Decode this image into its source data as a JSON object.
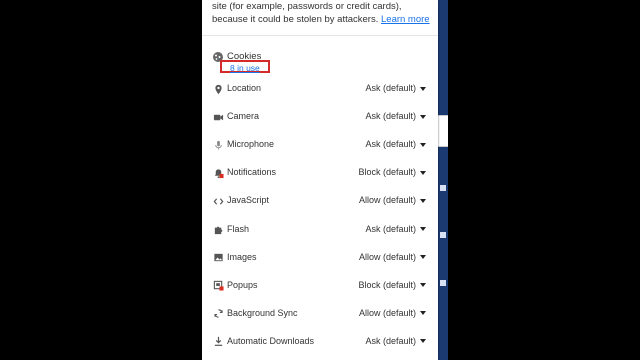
{
  "intro": {
    "text": "site (for example, passwords or credit cards), because it could be stolen by attackers.",
    "link": "Learn more"
  },
  "cookies": {
    "label": "Cookies",
    "in_use_link": "8 in use",
    "icon": "cookie-icon"
  },
  "permissions": [
    {
      "label": "Location",
      "value": "Ask (default)",
      "icon": "location-pin-icon"
    },
    {
      "label": "Camera",
      "value": "Ask (default)",
      "icon": "camera-icon"
    },
    {
      "label": "Microphone",
      "value": "Ask (default)",
      "icon": "microphone-icon"
    },
    {
      "label": "Notifications",
      "value": "Block (default)",
      "icon": "notifications-icon"
    },
    {
      "label": "JavaScript",
      "value": "Allow (default)",
      "icon": "code-icon"
    },
    {
      "label": "Flash",
      "value": "Ask (default)",
      "icon": "puzzle-icon"
    },
    {
      "label": "Images",
      "value": "Allow (default)",
      "icon": "image-icon"
    },
    {
      "label": "Popups",
      "value": "Block (default)",
      "icon": "popup-icon"
    },
    {
      "label": "Background Sync",
      "value": "Allow (default)",
      "icon": "sync-icon"
    },
    {
      "label": "Automatic Downloads",
      "value": "Ask (default)",
      "icon": "download-icon"
    }
  ],
  "colors": {
    "highlight": "#d42a2a",
    "link": "#1a73e8",
    "background_strip": "#1b3a72"
  }
}
